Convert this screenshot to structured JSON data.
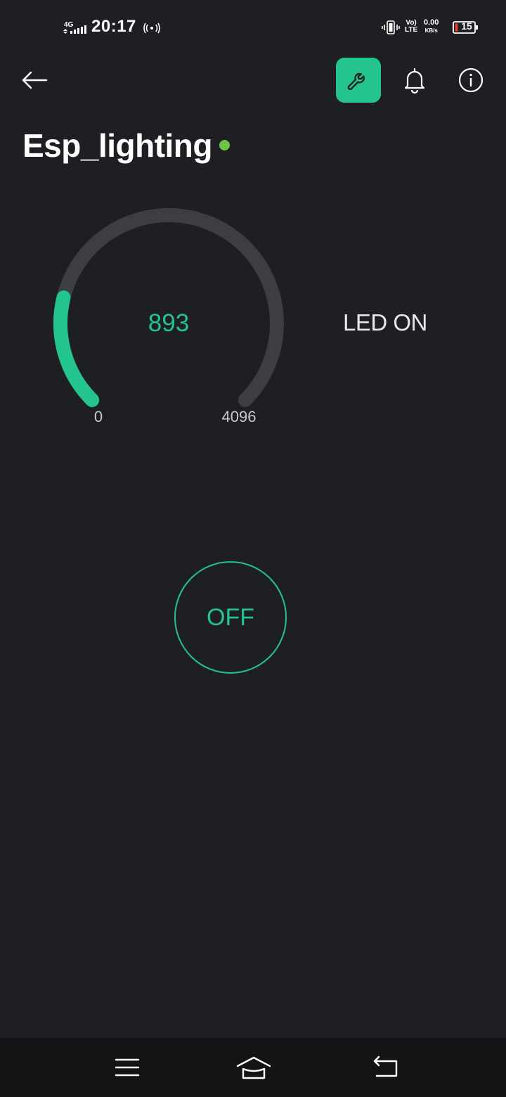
{
  "status_bar": {
    "network": "4G",
    "time": "20:17",
    "volte_top": "Vo)",
    "volte_bottom": "LTE",
    "speed_value": "0.00",
    "speed_unit": "KB/s",
    "battery": "15"
  },
  "header": {
    "title": "Esp_lighting",
    "online_color": "#6fc444",
    "accent": "#23c48e"
  },
  "gauge": {
    "value": 893,
    "value_text": "893",
    "min": 0,
    "max": 4096,
    "min_text": "0",
    "max_text": "4096",
    "fraction": 0.218
  },
  "led_status": "LED ON",
  "button": {
    "label": "OFF"
  },
  "icons": [
    "back-arrow-icon",
    "wrench-icon",
    "bell-icon",
    "info-icon",
    "menu-icon",
    "home-icon",
    "back-icon"
  ]
}
